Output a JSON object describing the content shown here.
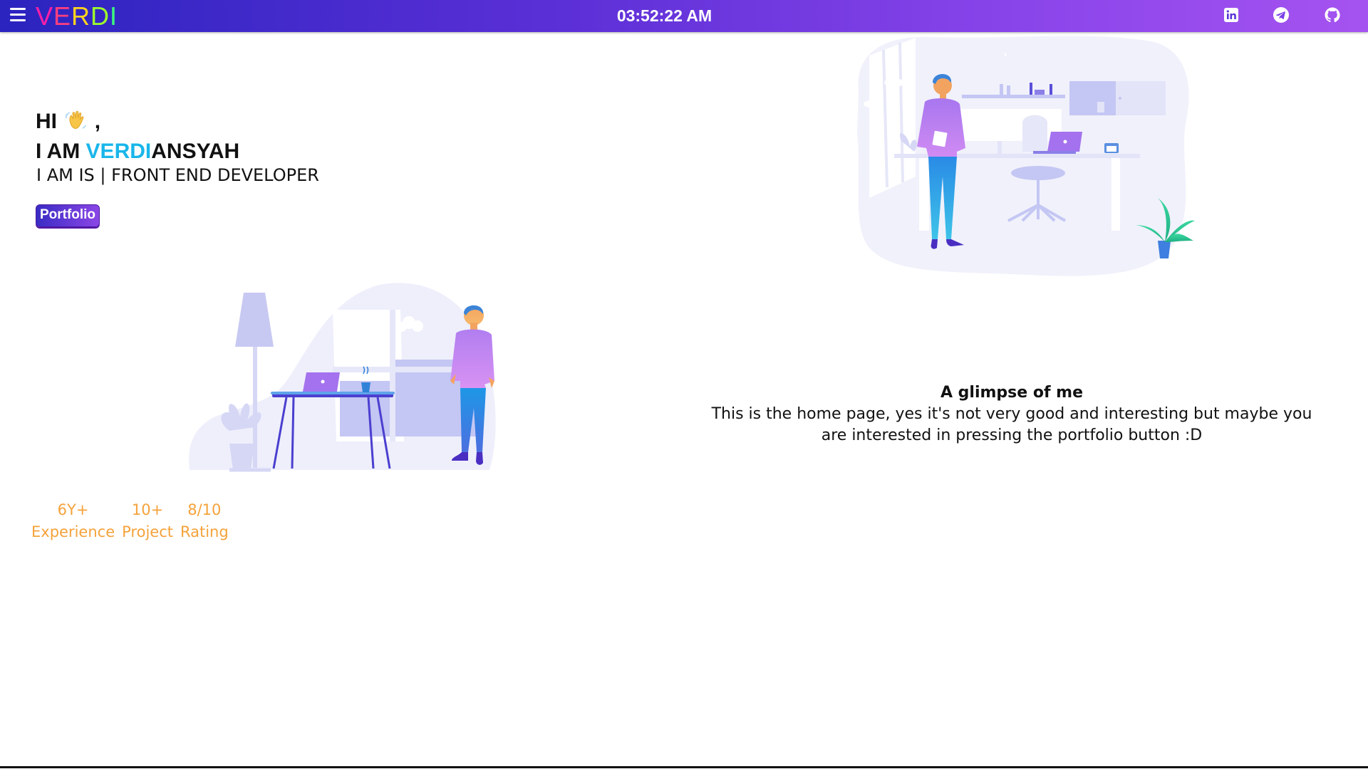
{
  "header": {
    "logo_letters": [
      {
        "char": "V",
        "color": "#ff1fa8"
      },
      {
        "char": "E",
        "color": "#ff3f7e"
      },
      {
        "char": "R",
        "color": "#ffd21f"
      },
      {
        "char": "D",
        "color": "#9dff2a"
      },
      {
        "char": "I",
        "color": "#3dff7a"
      }
    ],
    "clock": "03:52:22 AM",
    "social": [
      "linkedin-icon",
      "telegram-icon",
      "github-icon"
    ]
  },
  "hero": {
    "greeting": "HI",
    "greeting_suffix": ",",
    "iam_prefix": "I AM ",
    "name_highlight": "VERDI",
    "name_rest": "ANSYAH",
    "role": "I AM IS | FRONT END DEVELOPER",
    "portfolio_label": "Portfolio"
  },
  "stats": [
    {
      "value": "6Y+",
      "label": "Experience"
    },
    {
      "value": "10+",
      "label": "Project"
    },
    {
      "value": "8/10",
      "label": "Rating"
    }
  ],
  "glimpse": {
    "title": "A glimpse of me",
    "text": "This is the home page, yes it's not very good and interesting but maybe you are interested in pressing the portfolio button :D"
  },
  "colors": {
    "accent_name": "#19b6ea",
    "stat": "#f5a23a",
    "nav_start": "#2b24bf",
    "nav_end": "#a553f0"
  }
}
